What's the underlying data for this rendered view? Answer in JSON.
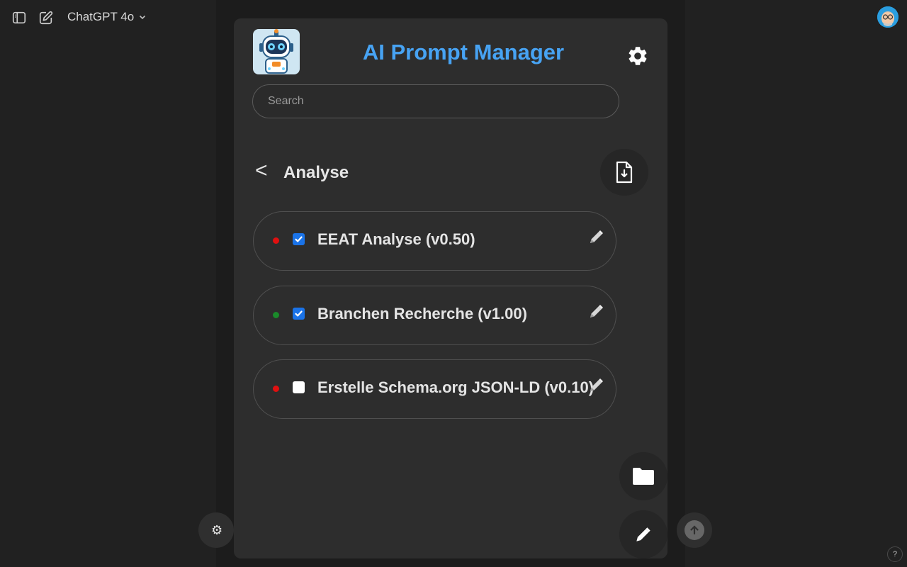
{
  "chatgpt": {
    "model_label": "ChatGPT 4o",
    "icons": [
      "sidebar-toggle-icon",
      "new-chat-icon",
      "chevron-down-icon",
      "user-avatar",
      "attach-icon",
      "arrow-up-icon",
      "help-icon"
    ],
    "help_label": "?"
  },
  "extension": {
    "title": "AI Prompt Manager",
    "title_color": "#47a3f3",
    "search": {
      "placeholder": "Search",
      "value": ""
    },
    "back_label": "<",
    "folder": "Analyse",
    "prompts": [
      {
        "label": "EEAT Analyse (v0.50)",
        "status_color": "#e01010",
        "checked": true
      },
      {
        "label": "Branchen Recherche (v1.00)",
        "status_color": "#1a8a2a",
        "checked": true
      },
      {
        "label": "Erstelle Schema.org JSON-LD (v0.10)",
        "status_color": "#e01010",
        "checked": false
      }
    ],
    "checkbox_checked_color": "#1a73e8"
  }
}
